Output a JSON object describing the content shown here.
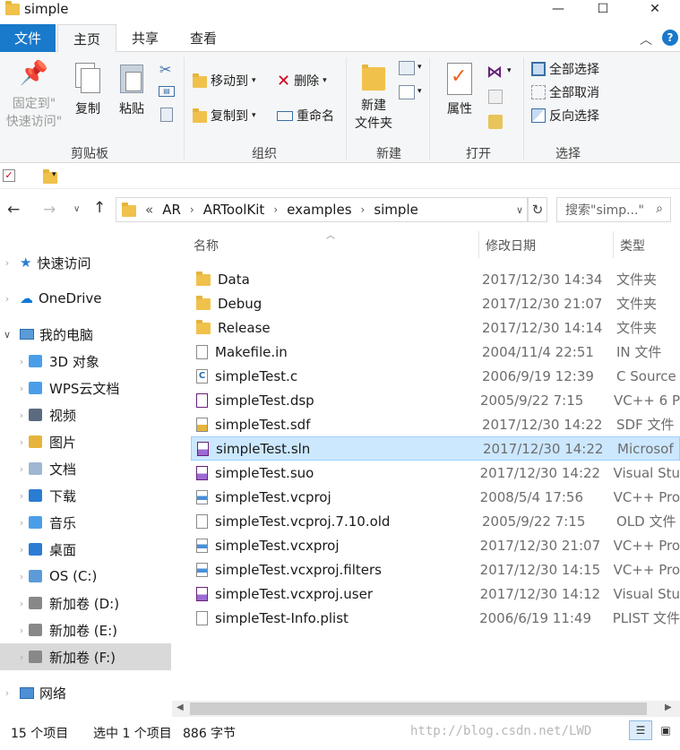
{
  "window": {
    "title": "simple"
  },
  "ribbon_tabs": {
    "file": "文件",
    "home": "主页",
    "share": "共享",
    "view": "查看"
  },
  "ribbon": {
    "clipboard": {
      "pin": "固定到\"快速访问\"",
      "pin_line1": "固定到\"",
      "pin_line2": "快速访问\"",
      "copy": "复制",
      "paste": "粘贴",
      "label": "剪贴板"
    },
    "organize": {
      "move_to": "移动到",
      "copy_to": "复制到",
      "delete": "删除",
      "rename": "重命名",
      "label": "组织"
    },
    "new": {
      "new_folder_line1": "新建",
      "new_folder_line2": "文件夹",
      "label": "新建"
    },
    "open": {
      "properties": "属性",
      "label": "打开"
    },
    "select": {
      "select_all": "全部选择",
      "select_none": "全部取消",
      "invert": "反向选择",
      "label": "选择"
    }
  },
  "address": {
    "prefix": "«",
    "crumbs": [
      "AR",
      "ARToolKit",
      "examples",
      "simple"
    ]
  },
  "search": {
    "placeholder": "搜索\"simp...\""
  },
  "nav": {
    "quick_access": "快速访问",
    "onedrive": "OneDrive",
    "this_pc": "我的电脑",
    "items": [
      "3D 对象",
      "WPS云文档",
      "视频",
      "图片",
      "文档",
      "下载",
      "音乐",
      "桌面",
      "OS (C:)",
      "新加卷 (D:)",
      "新加卷 (E:)",
      "新加卷 (F:)"
    ],
    "network": "网络"
  },
  "columns": {
    "name": "名称",
    "modified": "修改日期",
    "type": "类型"
  },
  "files": [
    {
      "name": "Data",
      "date": "2017/12/30 14:34",
      "type": "文件夹",
      "icon": "folder"
    },
    {
      "name": "Debug",
      "date": "2017/12/30 21:07",
      "type": "文件夹",
      "icon": "folder"
    },
    {
      "name": "Release",
      "date": "2017/12/30 14:14",
      "type": "文件夹",
      "icon": "folder"
    },
    {
      "name": "Makefile.in",
      "date": "2004/11/4 22:51",
      "type": "IN 文件",
      "icon": "doc"
    },
    {
      "name": "simpleTest.c",
      "date": "2006/9/19 12:39",
      "type": "C Source",
      "icon": "c-file"
    },
    {
      "name": "simpleTest.dsp",
      "date": "2005/9/22 7:15",
      "type": "VC++ 6 P",
      "icon": "dsp-file"
    },
    {
      "name": "simpleTest.sdf",
      "date": "2017/12/30 14:22",
      "type": "SDF 文件",
      "icon": "sdf-file"
    },
    {
      "name": "simpleTest.sln",
      "date": "2017/12/30 14:22",
      "type": "Microsof",
      "icon": "sln-file"
    },
    {
      "name": "simpleTest.suo",
      "date": "2017/12/30 14:22",
      "type": "Visual Stu",
      "icon": "suo-file"
    },
    {
      "name": "simpleTest.vcproj",
      "date": "2008/5/4 17:56",
      "type": "VC++ Pro",
      "icon": "vcproj-file"
    },
    {
      "name": "simpleTest.vcproj.7.10.old",
      "date": "2005/9/22 7:15",
      "type": "OLD 文件",
      "icon": "doc"
    },
    {
      "name": "simpleTest.vcxproj",
      "date": "2017/12/30 21:07",
      "type": "VC++ Pro",
      "icon": "vcproj-file"
    },
    {
      "name": "simpleTest.vcxproj.filters",
      "date": "2017/12/30 14:15",
      "type": "VC++ Pro",
      "icon": "vcproj-file"
    },
    {
      "name": "simpleTest.vcxproj.user",
      "date": "2017/12/30 14:12",
      "type": "Visual Stu",
      "icon": "suo-file"
    },
    {
      "name": "simpleTest-Info.plist",
      "date": "2006/6/19 11:49",
      "type": "PLIST 文件",
      "icon": "doc"
    }
  ],
  "selected_index": 7,
  "status": {
    "count": "15 个项目",
    "selected": "选中 1 个项目",
    "size": "886 字节",
    "watermark": "http://blog.csdn.net/LWD"
  },
  "colors": {
    "file_tab": "#1979ca",
    "selection": "#cce8ff",
    "nav_selected": "#d9d9d9"
  }
}
